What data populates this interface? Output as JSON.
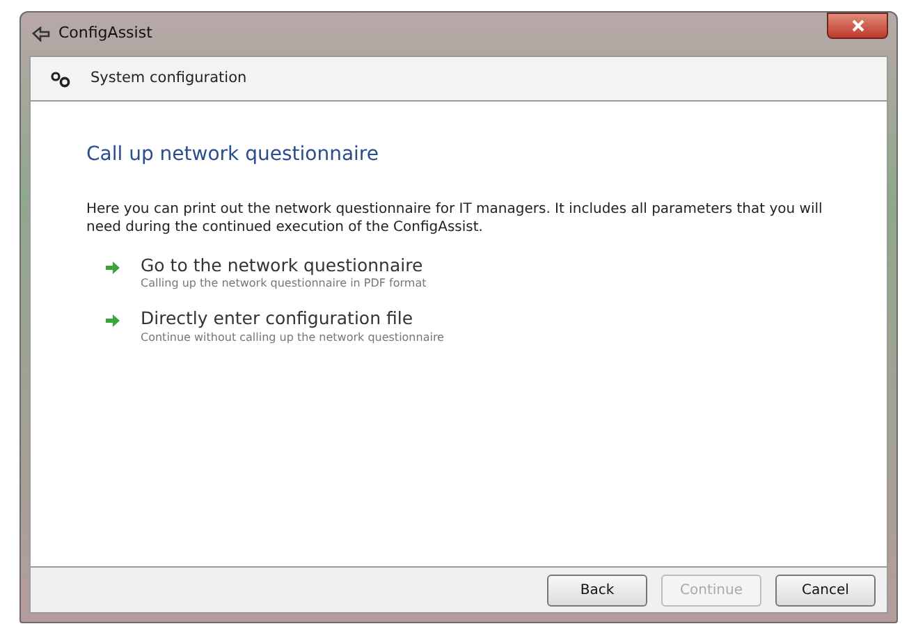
{
  "window": {
    "title": "ConfigAssist"
  },
  "header": {
    "title": "System configuration"
  },
  "content": {
    "heading": "Call up network questionnaire",
    "description": "Here you can print out the network questionnaire for IT managers. It includes all parameters that you will need during the continued execution of the ConfigAssist.",
    "options": [
      {
        "title": "Go to the network questionnaire",
        "subtitle": "Calling up the network questionnaire in PDF format"
      },
      {
        "title": "Directly enter configuration file",
        "subtitle": "Continue without calling up the network questionnaire"
      }
    ]
  },
  "buttons": [
    {
      "label": "Back",
      "disabled": false
    },
    {
      "label": "Continue",
      "disabled": true
    },
    {
      "label": "Cancel",
      "disabled": false
    }
  ]
}
